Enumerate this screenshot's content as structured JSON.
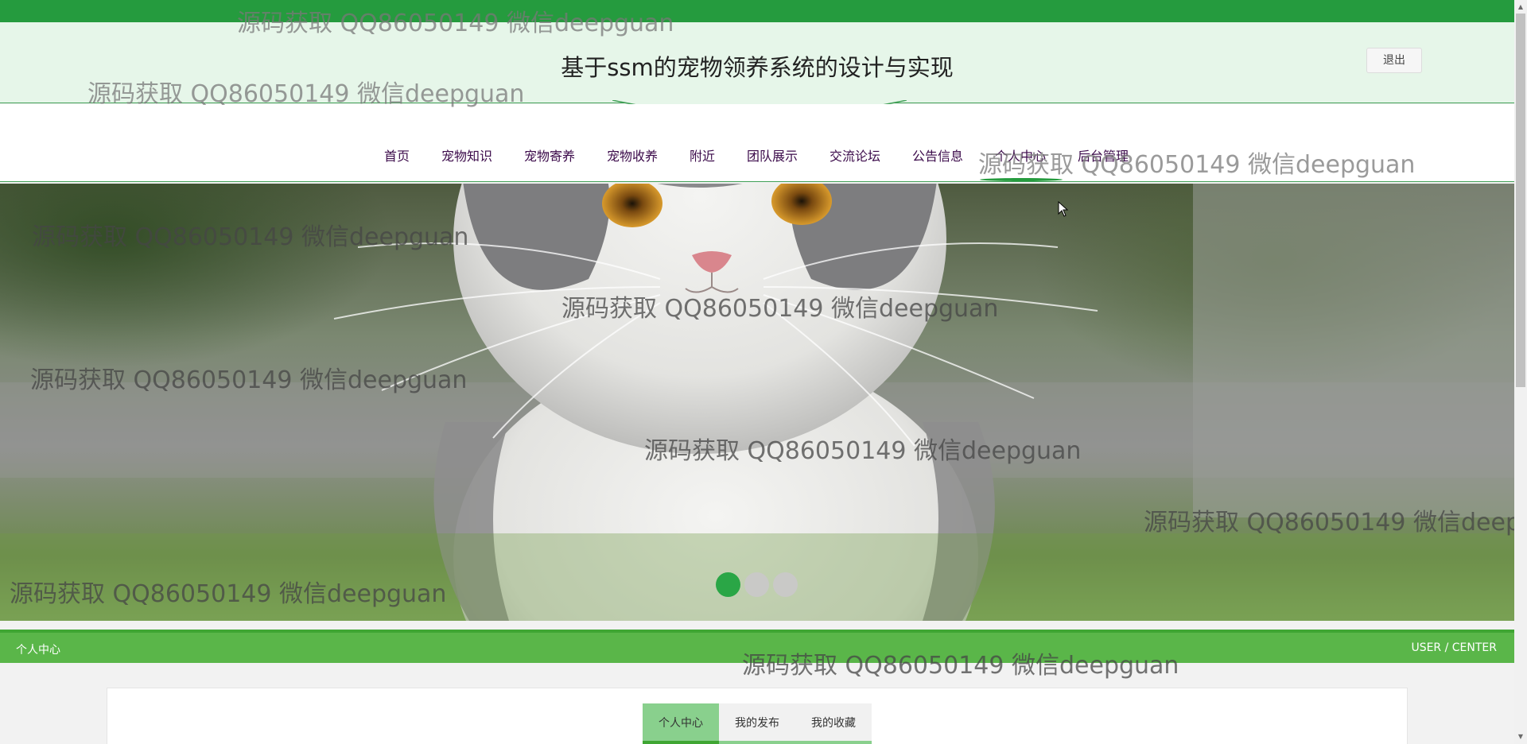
{
  "header": {
    "title": "基于ssm的宠物领养系统的设计与实现",
    "logout_label": "退出"
  },
  "nav": {
    "items": [
      {
        "label": "首页"
      },
      {
        "label": "宠物知识"
      },
      {
        "label": "宠物寄养"
      },
      {
        "label": "宠物收养"
      },
      {
        "label": "附近"
      },
      {
        "label": "团队展示"
      },
      {
        "label": "交流论坛"
      },
      {
        "label": "公告信息"
      },
      {
        "label": "个人中心"
      },
      {
        "label": "后台管理"
      }
    ],
    "active": "个人中心"
  },
  "banner": {
    "slide_count": 3,
    "active_index": 0,
    "image": "cat-photo"
  },
  "section": {
    "title": "个人中心",
    "subtitle": "USER / CENTER"
  },
  "tabs": [
    {
      "label": "个人中心"
    },
    {
      "label": "我的发布"
    },
    {
      "label": "我的收藏"
    }
  ],
  "watermark": {
    "text": "源码获取 QQ86050149 微信deepguan"
  },
  "colors": {
    "brand_green": "#259b3e",
    "section_green": "#5ab649",
    "header_bg": "#e6f6e9",
    "nav_text": "#3b0a4a"
  }
}
